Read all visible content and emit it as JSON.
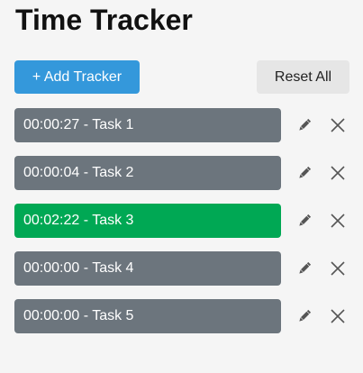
{
  "header": {
    "title": "Time Tracker"
  },
  "toolbar": {
    "add_label": "+ Add Tracker",
    "reset_label": "Reset All"
  },
  "colors": {
    "add_button": "#3498db",
    "reset_button": "#e6e6e6",
    "tracker_idle": "#6c757d",
    "tracker_running": "#00a854",
    "icon": "#555555"
  },
  "trackers": [
    {
      "text": "00:00:27 - Task 1",
      "active": false,
      "edit_icon": "pencil-icon",
      "delete_icon": "close-icon"
    },
    {
      "text": "00:00:04 - Task 2",
      "active": false,
      "edit_icon": "pencil-icon",
      "delete_icon": "close-icon"
    },
    {
      "text": "00:02:22 - Task 3",
      "active": true,
      "edit_icon": "pencil-icon",
      "delete_icon": "close-icon"
    },
    {
      "text": "00:00:00 - Task 4",
      "active": false,
      "edit_icon": "pencil-icon",
      "delete_icon": "close-icon"
    },
    {
      "text": "00:00:00 - Task 5",
      "active": false,
      "edit_icon": "pencil-icon",
      "delete_icon": "close-icon"
    }
  ]
}
